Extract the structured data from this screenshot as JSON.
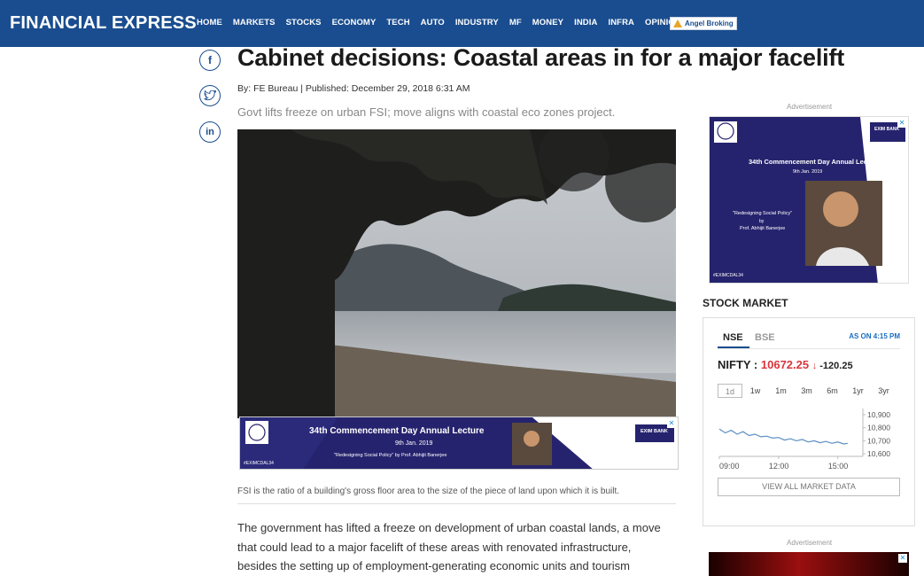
{
  "header": {
    "logo": "FINANCIAL EXPRESS",
    "nav": [
      "HOME",
      "MARKETS",
      "STOCKS",
      "ECONOMY",
      "TECH",
      "AUTO",
      "INDUSTRY",
      "MF",
      "MONEY",
      "INDIA",
      "INFRA",
      "OPINION"
    ],
    "sponsor": "Angel Broking"
  },
  "social": {
    "facebook": "f",
    "twitter": "t",
    "linkedin": "in"
  },
  "article": {
    "title": "Cabinet decisions: Coastal areas in for a major facelift",
    "byline": "By: FE Bureau | Published: December 29, 2018 6:31 AM",
    "subhead": "Govt lifts freeze on urban FSI; move aligns with coastal eco zones project.",
    "caption": "FSI is the ratio of a building's gross floor area to the size of the piece of land upon which it is built.",
    "body": "The government has lifted a freeze on development of urban coastal lands, a move that could lead to a major facelift of these areas with renovated infrastructure, besides the setting up of employment-generating economic units and tourism facilities."
  },
  "inline_ad": {
    "headline": "34th Commencement Day Annual Lecture",
    "date": "9th Jan. 2019",
    "tagline": "\"Redesigning Social Policy\"  by  Prof. Abhijit Banerjee",
    "hashtag": "#EXIMCDAL34",
    "brand": "EXIM BANK"
  },
  "right_ad": {
    "label": "Advertisement",
    "headline": "34th Commencement Day Annual Lecture",
    "date": "9th Jan. 2019",
    "topic": "\"Redesigning Social Policy\"",
    "by": "by",
    "speaker": "Prof. Abhijit Banerjee",
    "hashtag": "#EXIMCDAL34",
    "brand": "EXIM BANK"
  },
  "stock_market": {
    "heading": "STOCK MARKET",
    "tabs": [
      "NSE",
      "BSE"
    ],
    "as_of": "AS ON 4:15 PM",
    "index_name": "NIFTY :",
    "index_value": "10672.25",
    "change": "-120.25",
    "ranges": [
      "1d",
      "1w",
      "1m",
      "3m",
      "6m",
      "1yr",
      "3yr"
    ],
    "view_all": "VIEW ALL MARKET DATA"
  },
  "chart_data": {
    "type": "line",
    "x_tick_labels": [
      "09:00",
      "12:00",
      "15:00"
    ],
    "y_tick_labels": [
      "10,900",
      "10,800",
      "10,700",
      "10,600"
    ],
    "ylim": [
      10580,
      10920
    ],
    "x_range": [
      9.0,
      16.0
    ],
    "x": [
      9.0,
      9.3,
      9.6,
      9.9,
      10.2,
      10.5,
      10.8,
      11.1,
      11.4,
      11.7,
      12.0,
      12.3,
      12.6,
      12.9,
      13.2,
      13.5,
      13.8,
      14.1,
      14.4,
      14.7,
      15.0,
      15.3,
      15.5
    ],
    "values": [
      10790,
      10760,
      10780,
      10750,
      10770,
      10740,
      10750,
      10730,
      10735,
      10720,
      10725,
      10705,
      10715,
      10700,
      10710,
      10690,
      10700,
      10685,
      10695,
      10680,
      10690,
      10675,
      10680
    ],
    "color": "#5a8ec4",
    "grid": false
  },
  "bottom_ad": {
    "label": "Advertisement"
  },
  "colors": {
    "brand": "#1a4d8f",
    "negative": "#d9363e",
    "ad_bg": "#26236e"
  }
}
